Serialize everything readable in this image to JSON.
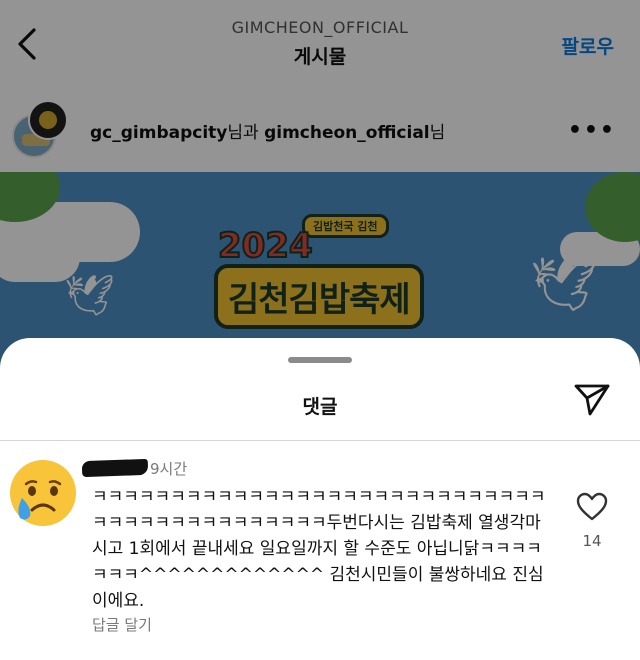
{
  "topbar": {
    "account": "GIMCHEON_OFFICIAL",
    "title": "게시물",
    "follow_label": "팔로우",
    "back_icon": "chevron-left-icon"
  },
  "post": {
    "author_primary": "gc_gimbapcity",
    "author_joiner": "님과 ",
    "author_secondary": "gimcheon_official",
    "author_suffix": "님",
    "more_icon": "more-horizontal-icon",
    "banner": {
      "tag": "김밥천국 김천",
      "year": "2024",
      "name": "김천김밥축제",
      "colors": {
        "sky": "#4f8fc4",
        "logo_yellow": "#f2c230",
        "logo_red": "#e24a3c",
        "logo_outline": "#1d3a2a"
      }
    }
  },
  "comments_sheet": {
    "title": "댓글",
    "share_icon": "send-icon",
    "comment": {
      "avatar_icon": "crying-face-emoji-icon",
      "username_redacted": true,
      "time": "9시간",
      "text": "ㅋㅋㅋㅋㅋㅋㅋㅋㅋㅋㅋㅋㅋㅋㅋㅋㅋㅋㅋㅋㅋㅋㅋㅋㅋㅋㅋㅋㅋㅋㅋㅋㅋㅋㅋㅋㅋㅋㅋㅋㅋㅋㅋㅋ두번다시는 김밥축제 열생각마시고 1회에서 끝내세요 일요일까지 할 수준도 아닙니닭ㅋㅋㅋㅋㅋㅋㅋ^^^^^^^^^^^^^ 김천시민들이 불쌍하네요 진심이에요.",
      "reply_label": "답글 달기",
      "like_icon": "heart-outline-icon",
      "like_count": "14"
    }
  },
  "colors": {
    "accent": "#0a7ae0",
    "dim_overlay": "rgba(0,0,0,0.42)"
  }
}
